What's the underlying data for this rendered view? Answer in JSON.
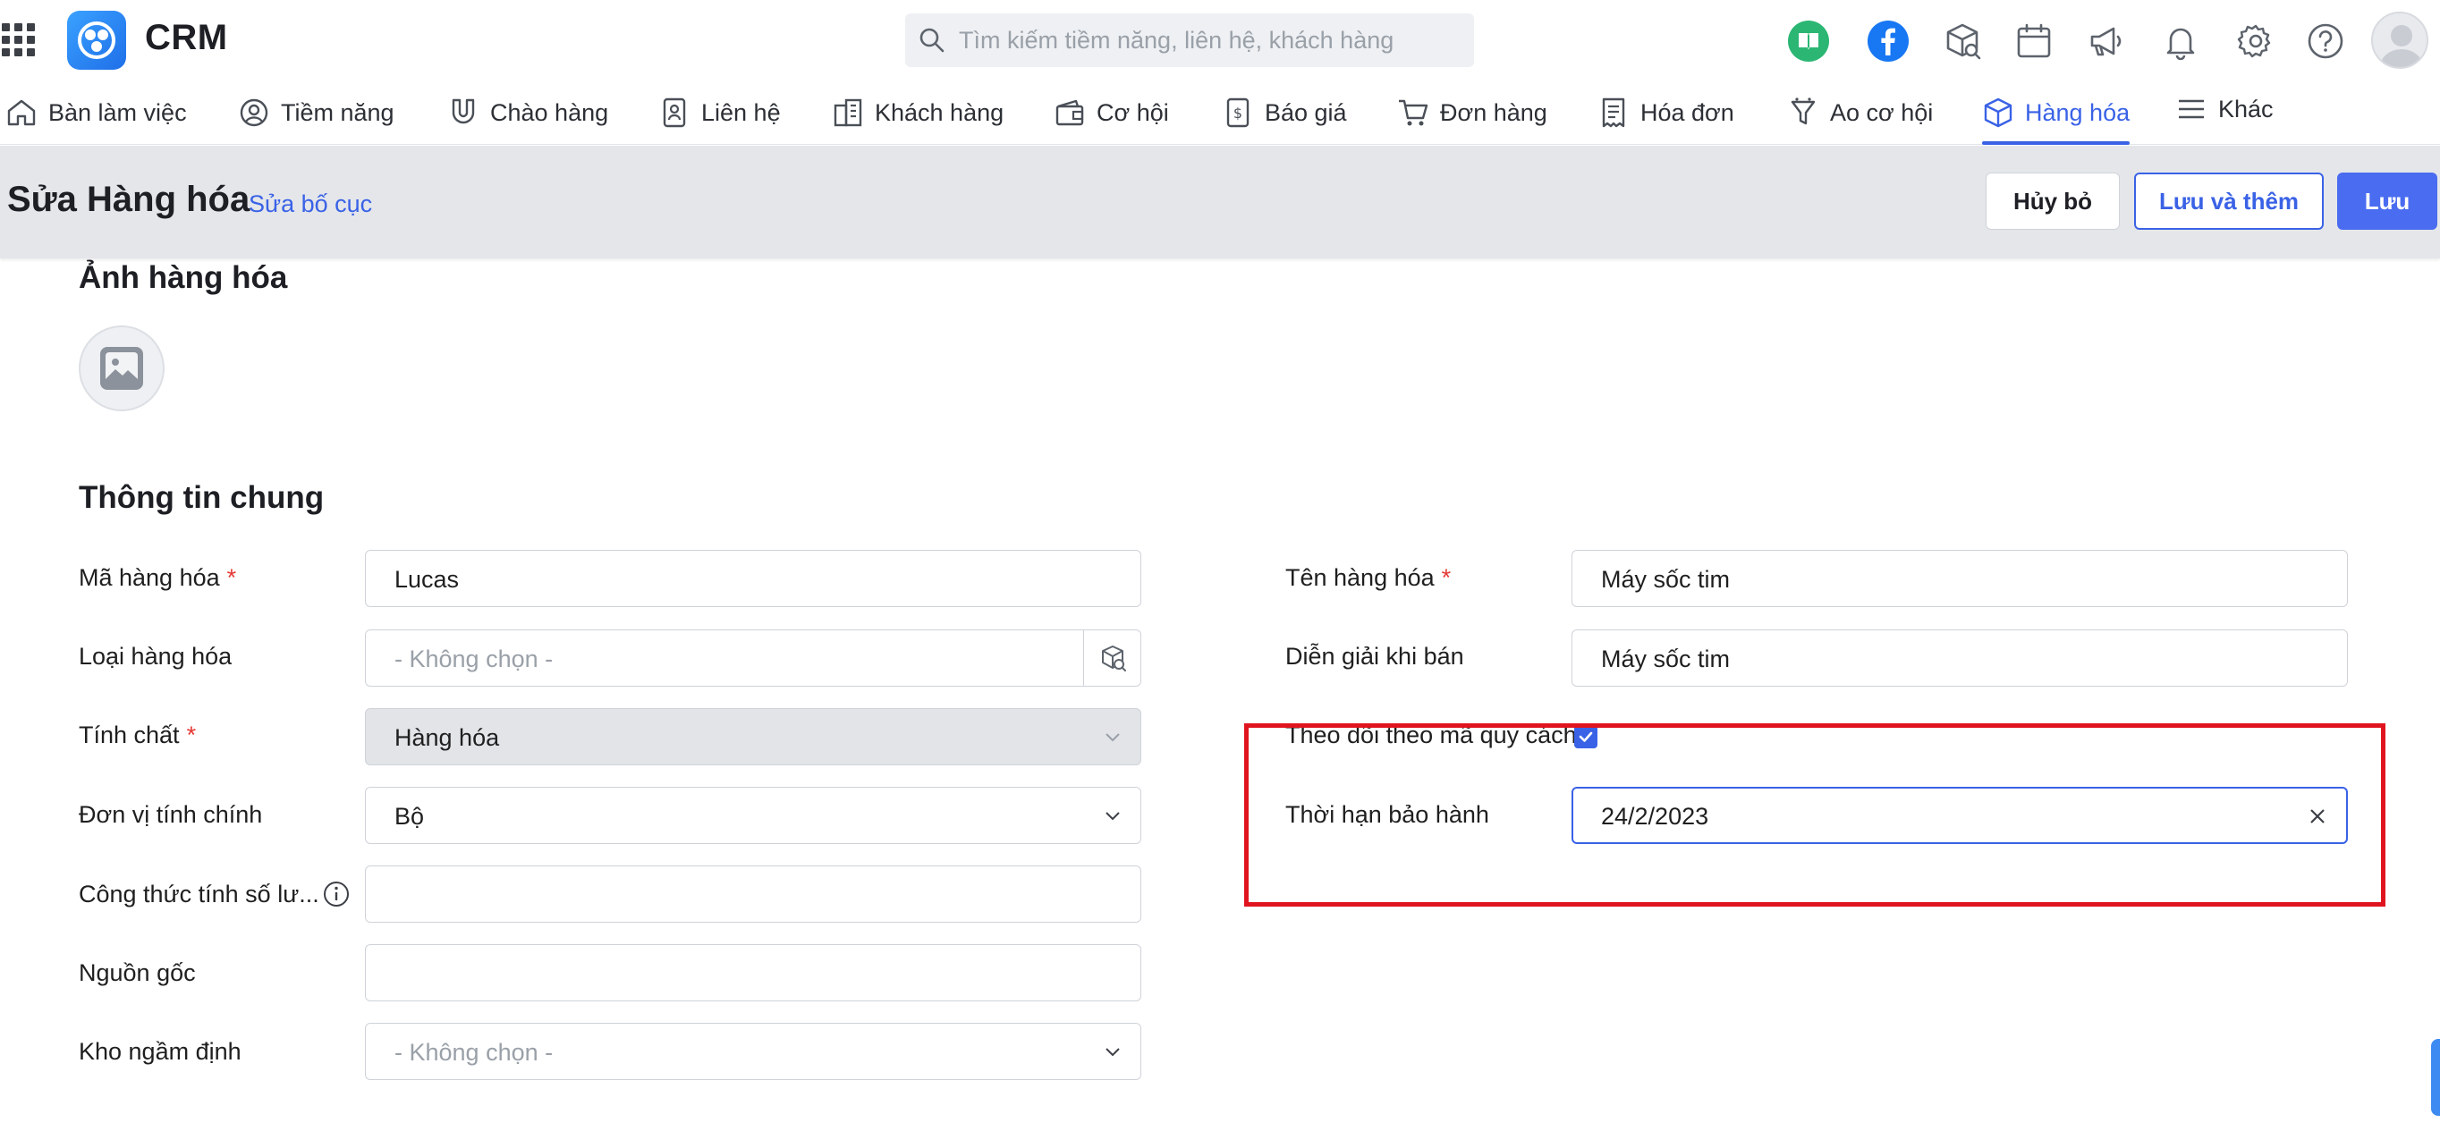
{
  "app": {
    "brand": "CRM"
  },
  "search": {
    "placeholder": "Tìm kiếm tiềm năng, liên hệ, khách hàng"
  },
  "top_icons": [
    "book-icon",
    "facebook-icon",
    "package-search-icon",
    "calendar-icon",
    "megaphone-icon",
    "bell-icon",
    "gear-icon",
    "help-icon",
    "avatar"
  ],
  "nav": {
    "items": [
      {
        "label": "Bàn làm việc",
        "icon": "home-icon"
      },
      {
        "label": "Tiềm năng",
        "icon": "user-circle-icon"
      },
      {
        "label": "Chào hàng",
        "icon": "magnet-icon"
      },
      {
        "label": "Liên hệ",
        "icon": "contact-card-icon"
      },
      {
        "label": "Khách hàng",
        "icon": "building-icon"
      },
      {
        "label": "Cơ hội",
        "icon": "wallet-icon"
      },
      {
        "label": "Báo giá",
        "icon": "dollar-doc-icon"
      },
      {
        "label": "Đơn hàng",
        "icon": "cart-icon"
      },
      {
        "label": "Hóa đơn",
        "icon": "invoice-icon"
      },
      {
        "label": "Ao cơ hội",
        "icon": "funnel-icon"
      },
      {
        "label": "Hàng hóa",
        "icon": "box-icon",
        "active": true
      },
      {
        "label": "Khác",
        "icon": "menu-icon"
      }
    ]
  },
  "page": {
    "title": "Sửa Hàng hóa",
    "layout_link": "Sửa bố cục",
    "buttons": {
      "cancel": "Hủy bỏ",
      "save_add": "Lưu và thêm",
      "save": "Lưu"
    }
  },
  "photo_section": {
    "title": "Ảnh hàng hóa"
  },
  "general": {
    "title": "Thông tin chung",
    "left": [
      {
        "label": "Mã hàng hóa",
        "required": "*",
        "value": "Lucas"
      },
      {
        "label": "Loại hàng hóa",
        "placeholder": "- Không chọn -"
      },
      {
        "label": "Tính chất",
        "required": "*",
        "value": "Hàng hóa"
      },
      {
        "label": "Đơn vị tính chính",
        "value": "Bộ"
      },
      {
        "label": "Công thức tính số lư...",
        "value": ""
      },
      {
        "label": "Nguồn gốc",
        "value": ""
      },
      {
        "label": "Kho ngầm định",
        "placeholder": "- Không chọn -"
      }
    ],
    "right": [
      {
        "label": "Tên hàng hóa",
        "required": "*",
        "value": "Máy sốc tim"
      },
      {
        "label": "Diễn giải khi bán",
        "value": "Máy sốc tim"
      },
      {
        "label": "Theo dõi theo mã quy cách",
        "checked": true
      },
      {
        "label": "Thời hạn bảo hành",
        "value": "24/2/2023"
      }
    ]
  },
  "colors": {
    "accent": "#3a62e6",
    "highlight": "#e0141e",
    "band": "#e4e6ea"
  }
}
